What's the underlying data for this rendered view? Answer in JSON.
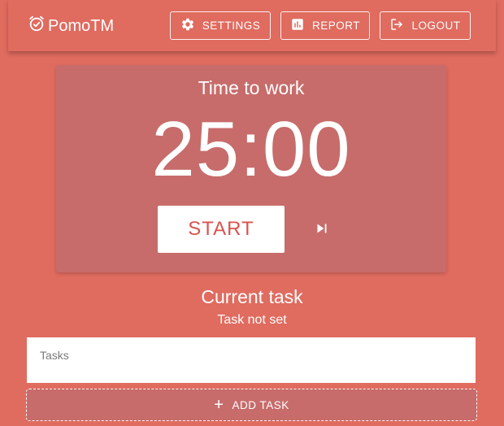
{
  "app": {
    "name": "PomoTM",
    "logo_icon": "alarm-check-icon"
  },
  "nav": {
    "settings": {
      "label": "SETTINGS",
      "icon": "gear-icon"
    },
    "report": {
      "label": "REPORT",
      "icon": "bar-chart-icon"
    },
    "logout": {
      "label": "LOGOUT",
      "icon": "logout-icon"
    }
  },
  "timer": {
    "title": "Time to work",
    "time": "25:00",
    "start_label": "START",
    "skip_icon": "skip-next-icon"
  },
  "task": {
    "heading": "Current task",
    "status": "Task not set",
    "input_placeholder": "Tasks",
    "add_label": "ADD TASK",
    "add_icon": "plus-icon"
  },
  "colors": {
    "background": "#e06b5f",
    "card": "#c76c6b",
    "start_text": "#d9534f",
    "white": "#ffffff"
  }
}
